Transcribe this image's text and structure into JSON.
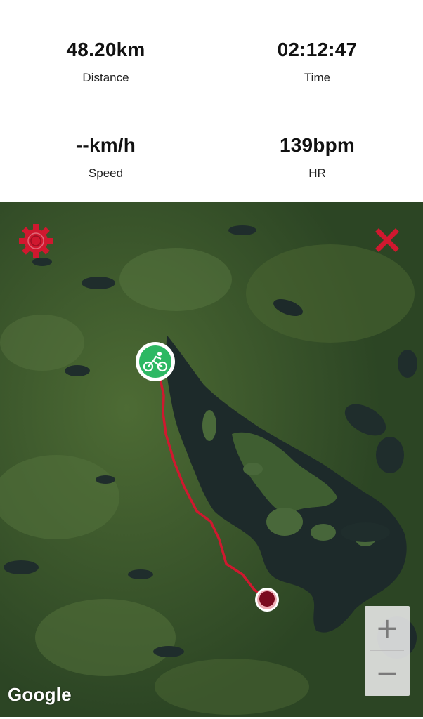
{
  "stats": {
    "distance": {
      "value": "48.20km",
      "label": "Distance"
    },
    "time": {
      "value": "02:12:47",
      "label": "Time"
    },
    "speed": {
      "value": "--km/h",
      "label": "Speed"
    },
    "hr": {
      "value": "139bpm",
      "label": "HR"
    }
  },
  "map": {
    "attribution": "Google",
    "zoom_in_label": "+",
    "zoom_out_label": "−",
    "route_color": "#d0182f",
    "start_marker_color": "#2db863",
    "end_marker_color": "#7a0a1e",
    "controls_color": "#d0182f",
    "icons": {
      "settings": "gear-icon",
      "close": "close-icon",
      "start": "bicycle-icon",
      "end": "finish-marker-icon"
    }
  }
}
